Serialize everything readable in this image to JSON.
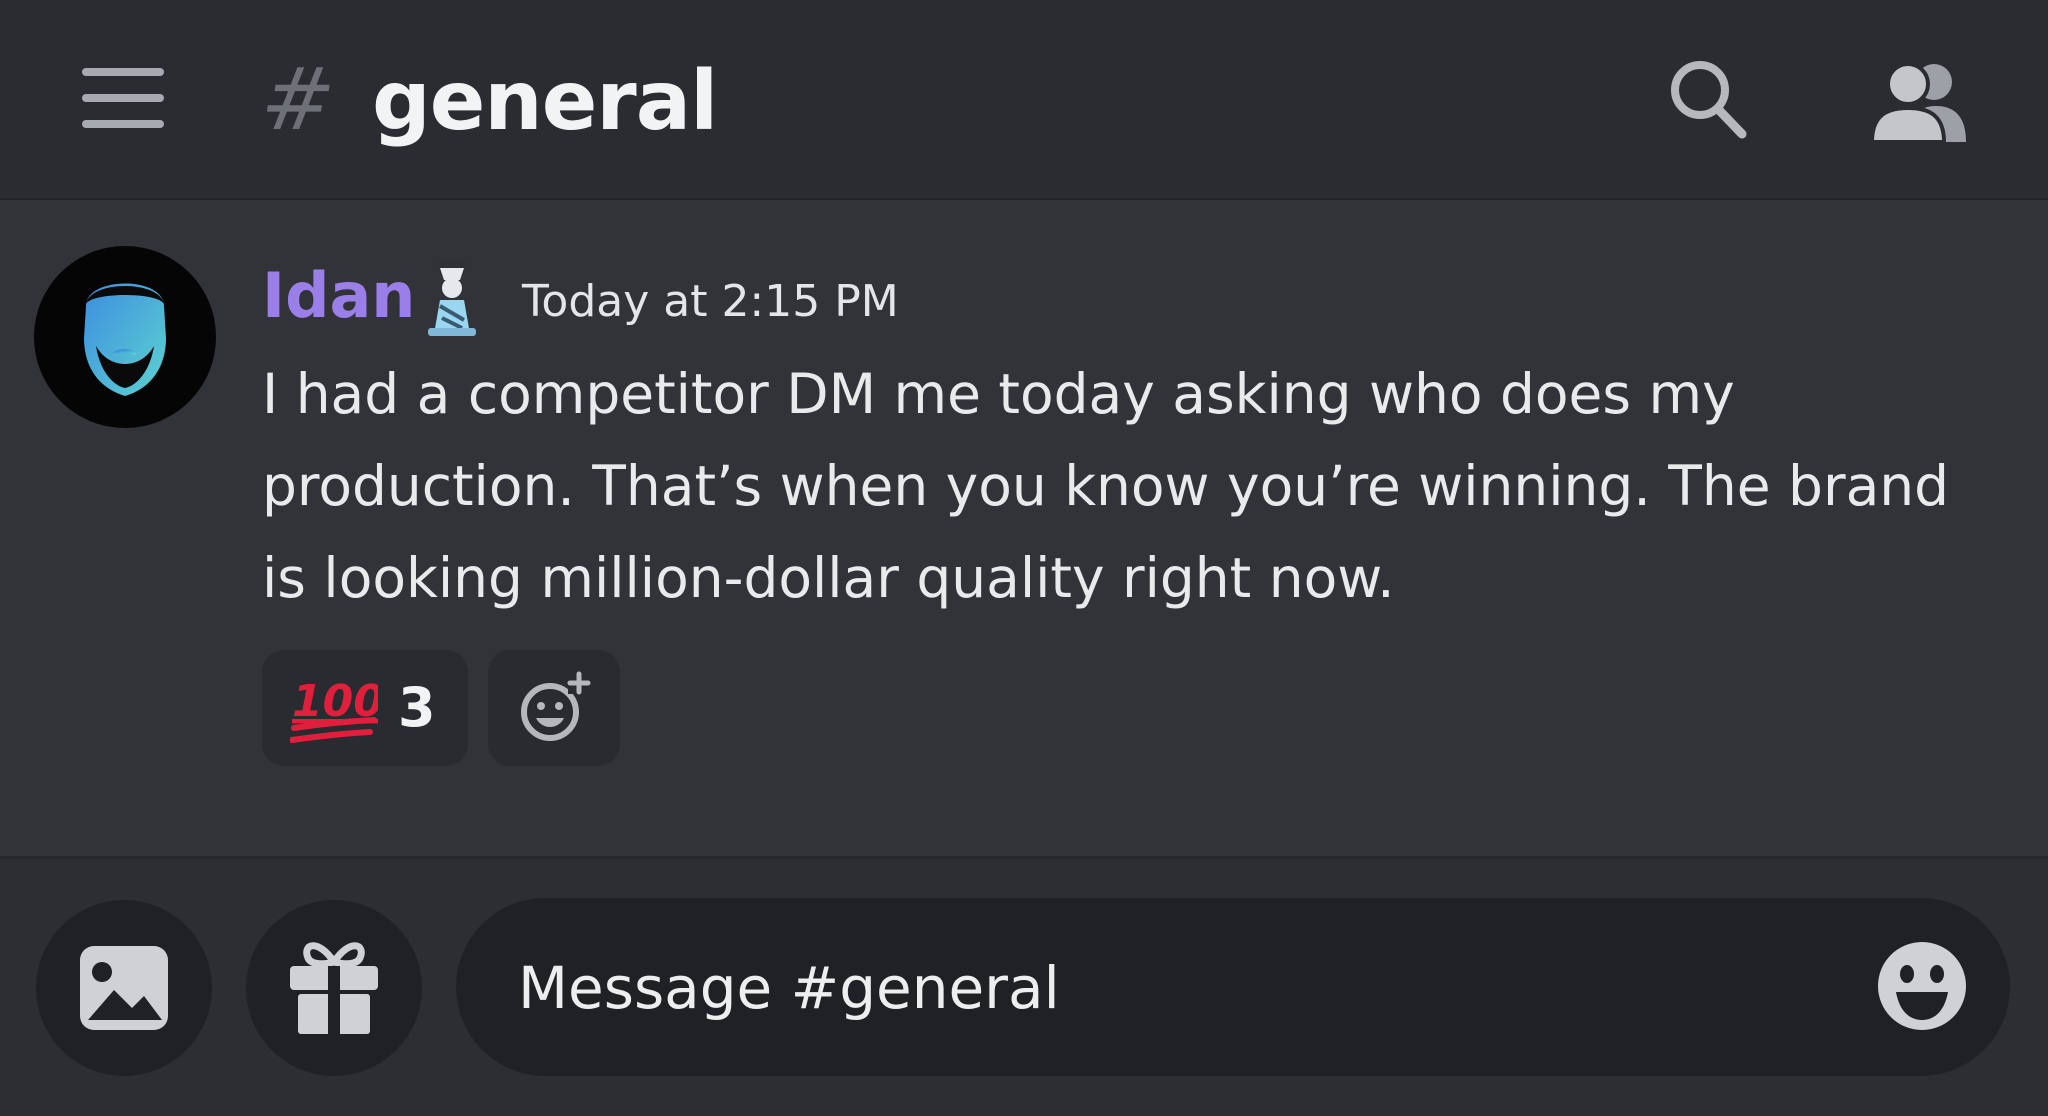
{
  "header": {
    "channel_prefix": "#",
    "channel_name": "general",
    "menu_icon": "hamburger-menu-icon",
    "search_icon": "search-icon",
    "members_icon": "members-icon"
  },
  "message": {
    "author": "Idan",
    "author_color": "#9b7fe8",
    "role_icon": "role-badge-icon",
    "timestamp": "Today at 2:15 PM",
    "text": "I had a competitor DM me today asking who does my production. That’s when you know you’re winning. The brand is looking million-dollar quality right now.",
    "reactions": [
      {
        "emoji": "hundred-points-emoji",
        "count": "3"
      }
    ],
    "add_reaction_icon": "add-reaction-icon"
  },
  "composer": {
    "placeholder": "Message #general",
    "image_icon": "image-icon",
    "gift_icon": "gift-icon",
    "emoji_icon": "emoji-icon"
  },
  "colors": {
    "background": "#323339",
    "header": "#2b2c31",
    "username": "#9b7fe8",
    "hundred_emoji": "#e01f3c"
  }
}
